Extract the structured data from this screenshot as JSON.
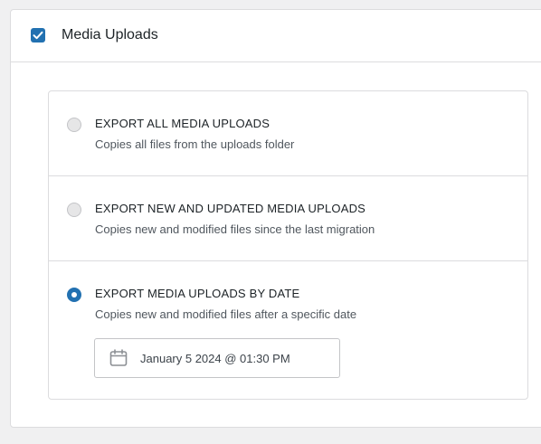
{
  "section": {
    "checked": true,
    "title": "Media Uploads"
  },
  "options": [
    {
      "title": "EXPORT ALL MEDIA UPLOADS",
      "description": "Copies all files from the uploads folder",
      "selected": false
    },
    {
      "title": "EXPORT NEW AND UPDATED MEDIA UPLOADS",
      "description": "Copies new and modified files since the last migration",
      "selected": false
    },
    {
      "title": "EXPORT MEDIA UPLOADS BY DATE",
      "description": "Copies new and modified files after a specific date",
      "selected": true
    }
  ],
  "date_picker": {
    "value": "January 5 2024 @ 01:30 PM",
    "icon": "calendar-icon"
  },
  "colors": {
    "accent": "#2271b1",
    "border": "#dcdcde",
    "background": "#f0f0f1"
  }
}
